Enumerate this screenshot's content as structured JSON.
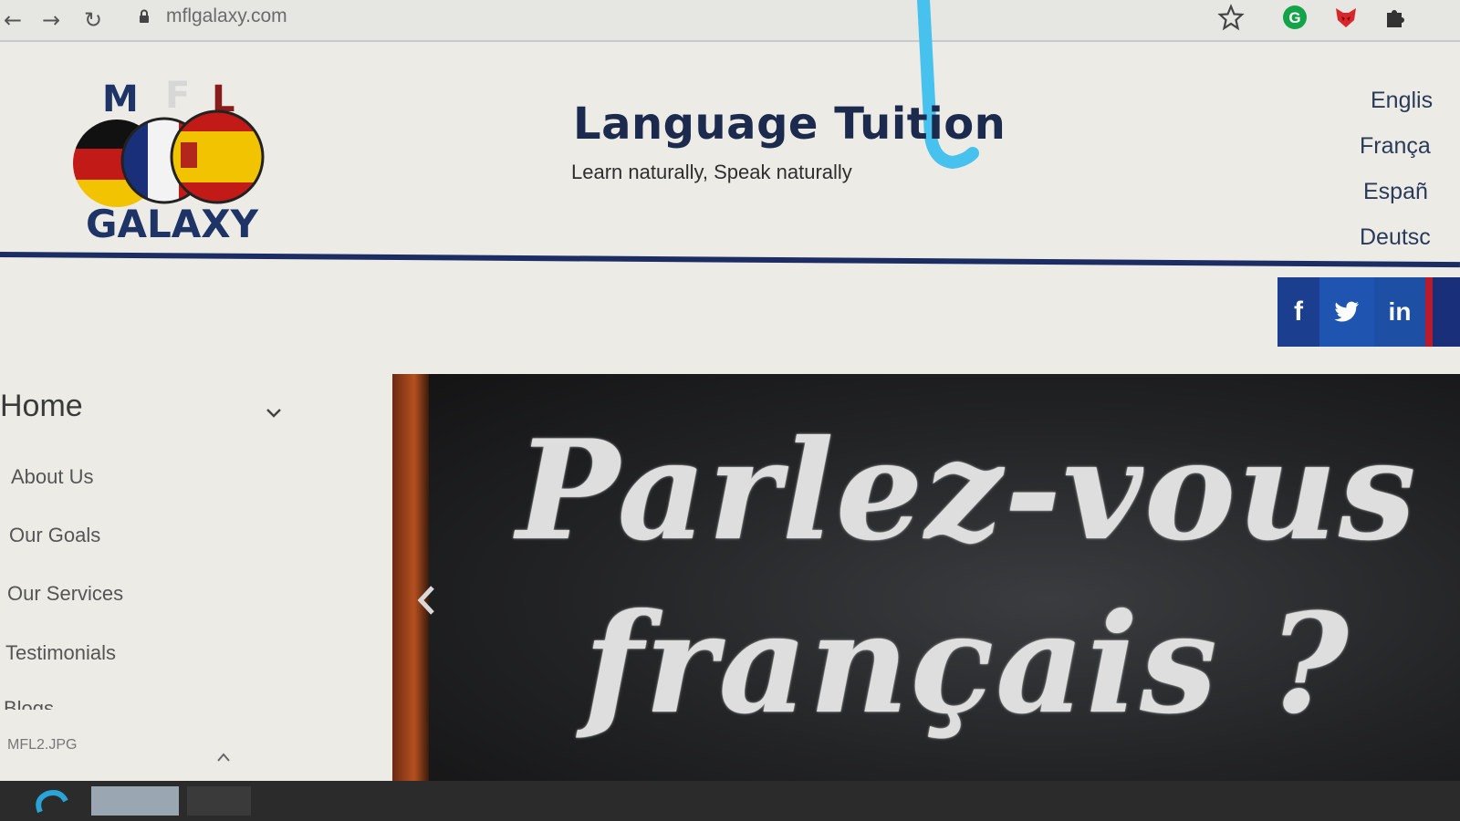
{
  "browser": {
    "url": "mflgalaxy.com",
    "back_icon": "arrow-left-icon",
    "forward_icon": "arrow-right-icon",
    "reload_icon": "reload-icon",
    "star_icon": "star-icon",
    "extensions": [
      "grammarly-icon",
      "fox-extension-icon",
      "puzzle-icon"
    ]
  },
  "site": {
    "logo": {
      "letters": "MFL",
      "word": "GALAXY"
    },
    "title": "Language Tuition",
    "tagline": "Learn naturally, Speak naturally",
    "languages": [
      "Englis",
      "França",
      "Españ",
      "Deutsc"
    ],
    "header_rule_color": "#1c2d63"
  },
  "social": {
    "facebook": "f",
    "twitter_icon": "twitter-icon",
    "linkedin": "in"
  },
  "nav": {
    "home": "Home",
    "items": [
      "About Us",
      "Our Goals",
      "Our Services",
      "Testimonials",
      "Blogs"
    ],
    "file_label": "MFL2.JPG"
  },
  "slider": {
    "line1": "Parlez-vous",
    "line2": "français ?"
  },
  "colors": {
    "accent": "#1c2d63",
    "facebook": "#1c3e8e",
    "twitter": "#1f55b0",
    "linkedin": "#1d4fa4"
  }
}
